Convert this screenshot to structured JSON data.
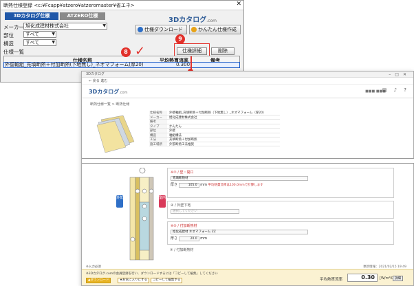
{
  "window": {
    "title": "断熱仕様登録 <c:¥Fcapp¥atzero¥atzeromaster¥省エネ>",
    "close": "✕",
    "tabs": [
      "3Dカタログ仕様",
      "ATZERO仕様"
    ],
    "maker_label": "メーカー",
    "maker_value": "旭化成建材株式会社",
    "part_label": "部位",
    "part_value": "すべて",
    "struct_label": "構造",
    "struct_value": "すべて",
    "list_label": "仕様一覧",
    "logo": "3Dカタログ",
    "logo_suffix": ".com",
    "download_btn": "仕様ダウンロード",
    "simple_btn": "かんたん仕様作成",
    "detail_btn": "仕様詳細",
    "delete_btn": "削除",
    "col_name": "仕様名称",
    "col_value": "平均熱貫流率",
    "col_note": "備考",
    "row_name": "外壁軸組_充填断熱＋付加断熱(下地無し)_ネオマフォーム(厚20)",
    "row_value": "0.300",
    "callout8": "8",
    "callout9": "9",
    "check": "✓"
  },
  "browser": {
    "tab_title": "3Dカタログ",
    "nav": "← 戻る   進む",
    "logo": "3Dカタログ",
    "logo_suffix": ".com",
    "user": "■■■ ■■■",
    "icons": "▤ ♪ ?",
    "breadcrumb": "断熱仕様一覧  >  断熱仕様",
    "info": [
      {
        "k": "仕様名称",
        "v": "外壁軸組_充填断熱＋付加断熱（下地無し）_ネオマフォーム（厚20）"
      },
      {
        "k": "メーカー",
        "v": "旭化成建材株式会社"
      },
      {
        "k": "備考",
        "v": ""
      },
      {
        "k": "タイプ",
        "v": "かんたん"
      },
      {
        "k": "部位",
        "v": "外壁"
      },
      {
        "k": "構造",
        "v": "軸組構法"
      },
      {
        "k": "工法",
        "v": "充填断熱＋付加断熱"
      },
      {
        "k": "施工場所",
        "v": "外張断熱工法推奨"
      }
    ],
    "outside_label": "外気",
    "inside_label": "室内",
    "block1_head": "※② / 壁・開口",
    "block1_input": "充填断熱材",
    "block1_thick": "厚さ",
    "block1_val": "105.0",
    "block1_unit": "mm",
    "block1_note": "平均熱貫流率は100.0mmで計算します",
    "block2_head": "④ / 外壁下地",
    "block2_input": "選択してください",
    "block3_head": "※⑤ / 付加断熱材",
    "block3_input": "旭化成建材   ネオマフォーム ZZ",
    "block3_thick": "厚さ",
    "block3_val": "20.0",
    "block3_unit": "mm",
    "block4_head": "⑦ / 付加断熱材",
    "footer_note": "※入力必須",
    "footer_date": "更新情報：2021/02/15 19:49",
    "fb_text": "※3Dカタログ.comの会員登録を行い、ダウンロードするには「コピーして編集」してください",
    "fb_btn1": "▲ダウンロード",
    "fb_btn2": "★お気に入りにする",
    "fb_btn3": "コピーして編集する",
    "fb_label": "平均熱貫流率",
    "fb_value": "0.30",
    "fb_unit": "[W/m²K]",
    "fb_change": "詳細"
  }
}
